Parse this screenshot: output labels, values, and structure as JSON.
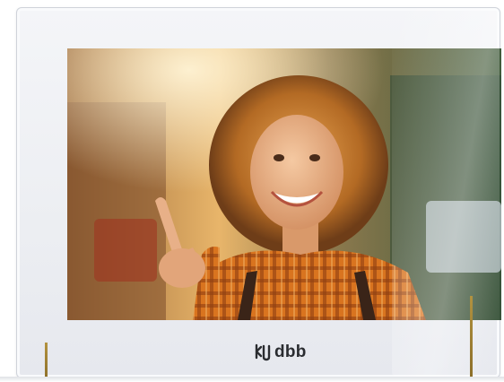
{
  "device": {
    "brand_name": "dbb",
    "brand_icon": "dbb-logo-icon"
  },
  "screen": {
    "content": "video-call-feed"
  },
  "colors": {
    "bezel": "#eceef2",
    "accent_led": "#a88a38",
    "brand_text": "#2a2c30"
  }
}
